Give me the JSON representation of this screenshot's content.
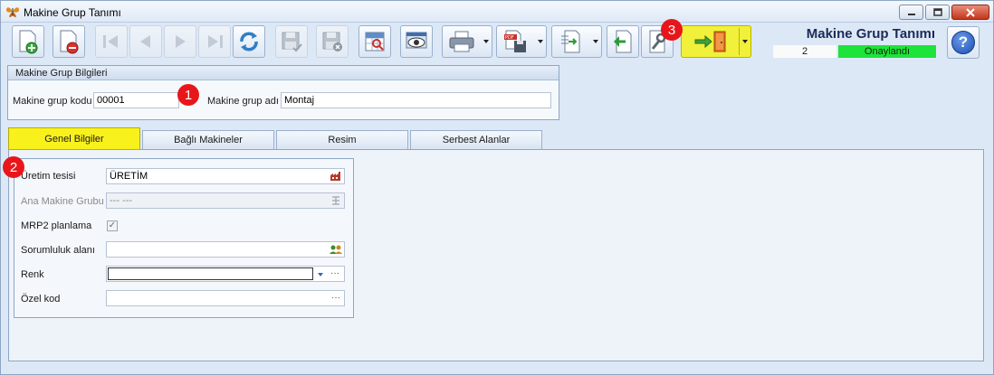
{
  "window": {
    "title": "Makine Grup Tanımı"
  },
  "icons": {
    "app": "butterfly-icon",
    "new": "new-document-icon",
    "delete": "delete-document-icon",
    "first": "first-record-icon",
    "prev": "previous-record-icon",
    "next": "next-record-icon",
    "last": "last-record-icon",
    "refresh": "refresh-icon",
    "save": "save-icon",
    "save_close": "save-close-icon",
    "preview": "report-preview-icon",
    "view": "view-eye-icon",
    "print": "printer-icon",
    "export_pdf": "pdf-export-icon",
    "import": "import-document-icon",
    "back": "go-back-icon",
    "settings": "wrench-icon",
    "exit": "exit-door-icon",
    "help": "help-icon"
  },
  "header": {
    "title": "Makine Grup Tanımı",
    "record_no": "2",
    "status": "Onaylandı",
    "status_color": "#1ee33a"
  },
  "help_label": "?",
  "group": {
    "title": "Makine Grup Bilgileri",
    "code_label": "Makine grup kodu",
    "code_value": "00001",
    "name_label": "Makine grup adı",
    "name_value": "Montaj"
  },
  "tabs": [
    {
      "label": "Genel Bilgiler",
      "active": true
    },
    {
      "label": "Bağlı Makineler",
      "active": false
    },
    {
      "label": "Resim",
      "active": false
    },
    {
      "label": "Serbest Alanlar",
      "active": false
    }
  ],
  "form": {
    "uretim_label": "Üretim tesisi",
    "uretim_value": "ÜRETİM",
    "ana_label": "Ana Makine Grubu",
    "ana_value": "--- ---",
    "mrp_label": "MRP2 planlama",
    "mrp_checked": "✓",
    "sorumluluk_label": "Sorumluluk alanı",
    "sorumluluk_value": "",
    "renk_label": "Renk",
    "renk_value": "",
    "ozel_label": "Özel kod",
    "ozel_value": "",
    "ellipsis": "···"
  },
  "badges": [
    "1",
    "2",
    "3"
  ],
  "colors": {
    "accent_tab": "#f9f11c",
    "exit_button": "#f1f03a",
    "badge": "#e8161a"
  }
}
